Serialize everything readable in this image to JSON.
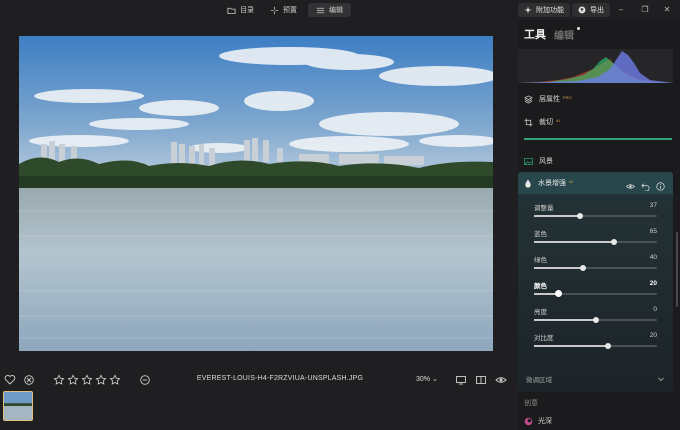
{
  "topbar": {
    "tabs": [
      {
        "label": "目录",
        "icon": "folder-icon",
        "active": false
      },
      {
        "label": "预置",
        "icon": "sparkle-icon",
        "active": false
      },
      {
        "label": "编辑",
        "icon": "sliders-icon",
        "active": true
      }
    ],
    "addon_label": "附加功能",
    "export_label": "导出",
    "window_controls": [
      "–",
      "❐",
      "✕"
    ]
  },
  "photo": {
    "description_icon": "landscape-photo"
  },
  "bottombar": {
    "filename": "EVEREST-LOUIS-H4-F2RZVIUA-UNSPLASH.JPG",
    "zoom": "30%",
    "zoom_chevron": "⌄",
    "rating": 0,
    "stars": 5
  },
  "panel": {
    "title": "工具",
    "subtitle": "编辑",
    "rows": [
      {
        "label": "层属性",
        "badge": "PRO",
        "icon": "layers-icon"
      },
      {
        "label": "裁切",
        "badge": "AI",
        "icon": "crop-icon"
      },
      {
        "label": "风景",
        "badge": "",
        "icon": "landscape-icon"
      }
    ],
    "section": {
      "title": "水景增强",
      "badge": "AI",
      "sliders": [
        {
          "label": "调整量",
          "value": 37,
          "min": 0,
          "max": 100,
          "active": false
        },
        {
          "label": "蓝色",
          "value": 65,
          "min": 0,
          "max": 100,
          "active": false
        },
        {
          "label": "绿色",
          "value": 40,
          "min": 0,
          "max": 100,
          "active": false
        },
        {
          "label": "颜色",
          "value": 20,
          "min": 0,
          "max": 100,
          "active": true
        },
        {
          "label": "亮度",
          "value": 0,
          "min": -100,
          "max": 100,
          "active": false
        },
        {
          "label": "对比度",
          "value": 20,
          "min": -100,
          "max": 100,
          "active": false
        }
      ],
      "footer": "微调区域"
    },
    "creative_label": "创意",
    "lightdeep_label": "光深"
  },
  "colors": {
    "accent_green": "#2fa37a",
    "thumb_border": "#e2c27a",
    "section_head": "#27474c"
  }
}
